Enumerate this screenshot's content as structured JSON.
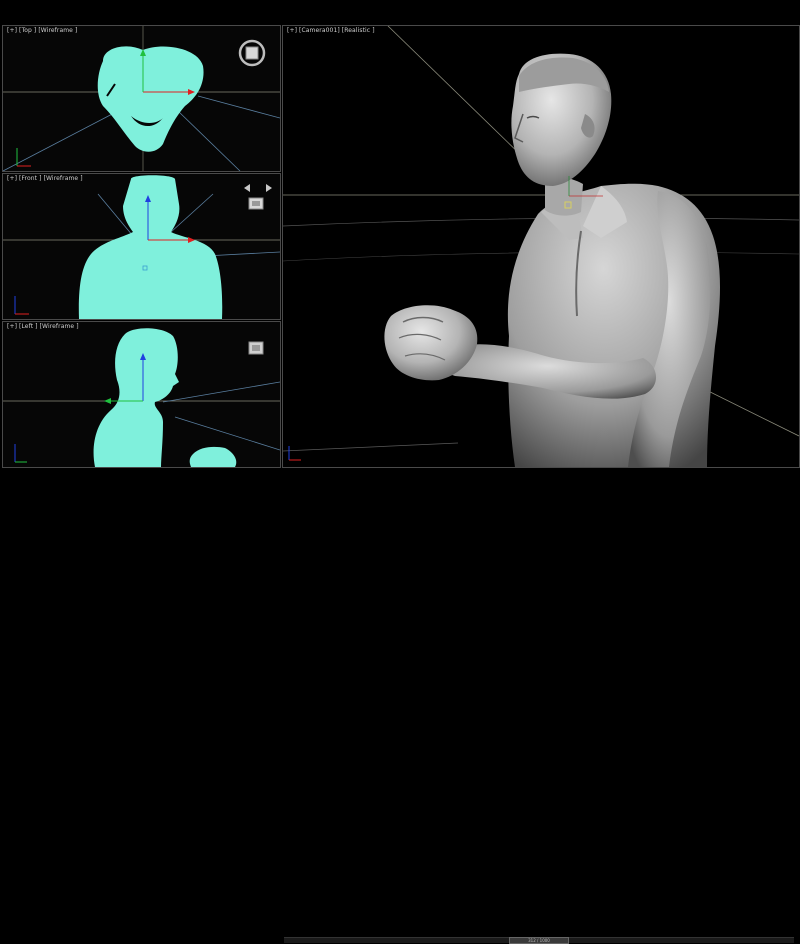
{
  "viewports": {
    "top": {
      "label": "[+] [Top ] [Wireframe ]"
    },
    "front": {
      "label": "[+] [Front ] [Wireframe ]"
    },
    "left": {
      "label": "[+] [Left ] [Wireframe ]"
    },
    "camera": {
      "label": "[+] [Camera001] [Realistic ]"
    }
  },
  "timeline": {
    "slider_text": "312 / 1000"
  },
  "colors": {
    "model_fill": "#7ff0dc",
    "scan_surface": "#c9c9c9",
    "grid_line": "#8a8a7a",
    "axis_x": "#e02020",
    "axis_y": "#20c040",
    "axis_z": "#2040e0",
    "frustum_line": "#5a7fa0"
  },
  "icons": [
    "viewcube-icon",
    "gizmo-icon"
  ]
}
